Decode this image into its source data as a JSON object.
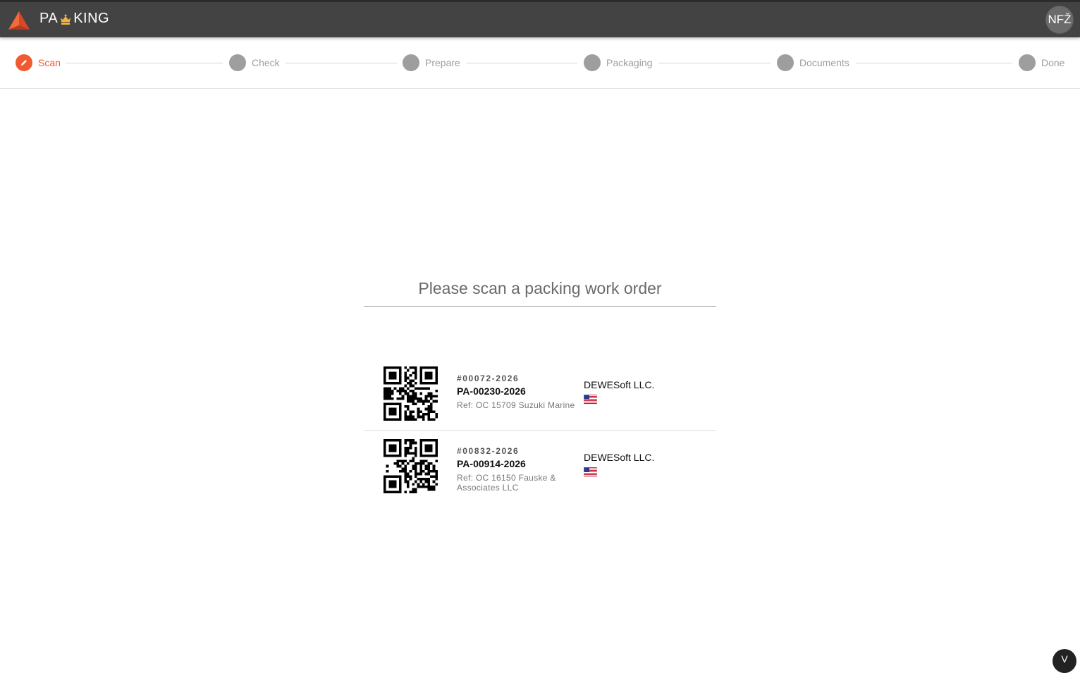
{
  "app": {
    "title_left": "PA",
    "title_right": "KING",
    "logo_icon": "triangle-logo-icon",
    "crown_icon": "crown-icon",
    "user_initials": "NFŽ",
    "accent_color": "#f05a32"
  },
  "steps": [
    {
      "label": "Scan",
      "state": "active",
      "icon": "pencil-icon"
    },
    {
      "label": "Check",
      "state": "pending"
    },
    {
      "label": "Prepare",
      "state": "pending"
    },
    {
      "label": "Packaging",
      "state": "pending"
    },
    {
      "label": "Documents",
      "state": "pending"
    },
    {
      "label": "Done",
      "state": "pending"
    }
  ],
  "scan": {
    "placeholder": "Please scan a packing work order"
  },
  "orders": [
    {
      "number": "#00072-2026",
      "code": "PA-00230-2026",
      "ref": "Ref: OC 15709 Suzuki Marine",
      "customer": "DEWESoft LLC.",
      "flag": "us-flag-icon"
    },
    {
      "number": "#00832-2026",
      "code": "PA-00914-2026",
      "ref": "Ref: OC 16150 Fauske & Associates LLC",
      "customer": "DEWESoft LLC.",
      "flag": "us-flag-icon"
    }
  ],
  "corner_button": {
    "icon": "chevron-down-icon",
    "glyph": "V"
  }
}
